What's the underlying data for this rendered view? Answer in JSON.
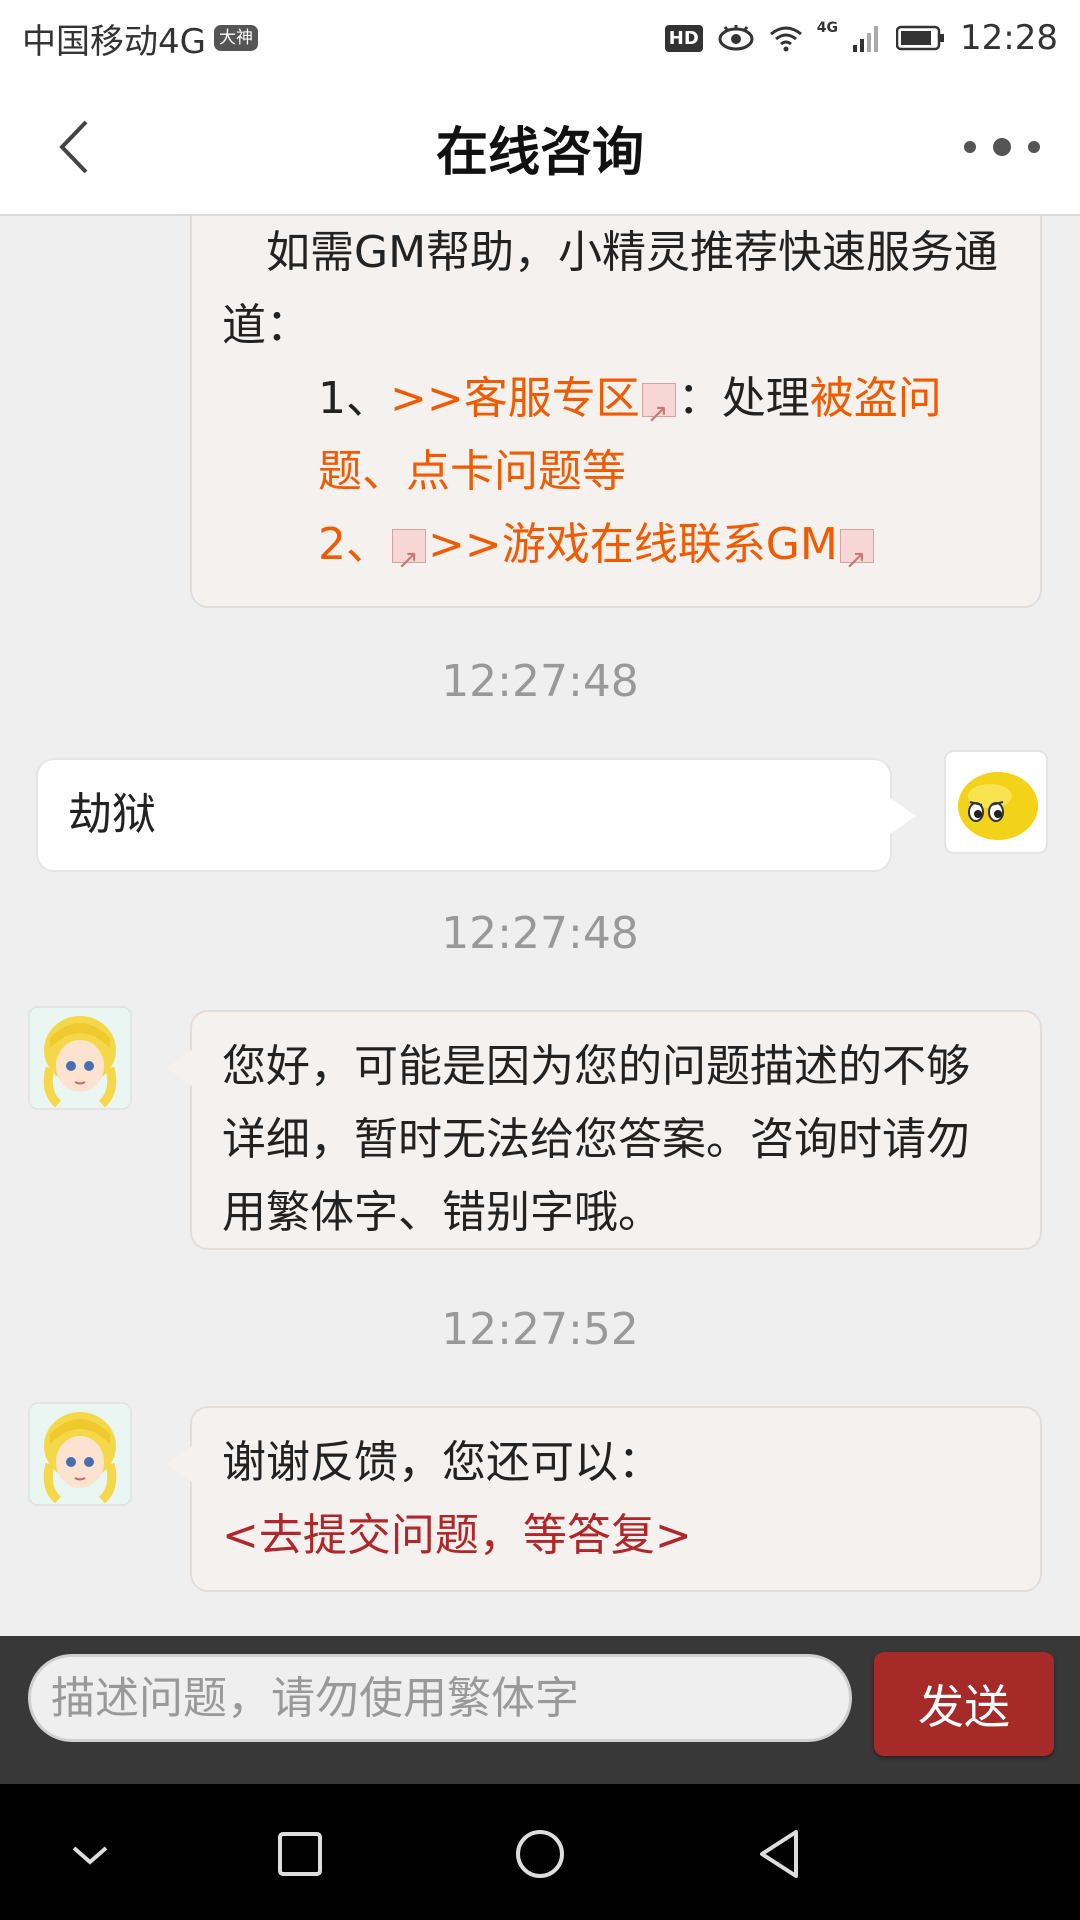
{
  "status_bar": {
    "carrier": "中国移动4G",
    "carrier_badge": "大神",
    "hd_label": "HD",
    "network_label": "4G",
    "time": "12:28"
  },
  "nav": {
    "title": "在线咨询",
    "back_icon": "chevron-left-icon",
    "more_icon": "more-dots-icon"
  },
  "messages": {
    "m1": {
      "line1": "如需GM帮助，小精灵推荐快速服务通道：",
      "item1_prefix": "1、",
      "item1_link": ">>客服专区",
      "item1_mid": "：处理",
      "item1_highlight": "被盗问题、点卡问题等",
      "item2_prefix": "2、",
      "item2_link": ">>游戏在线联系GM"
    },
    "t1": "12:27:48",
    "m2": {
      "text": "劫狱"
    },
    "t2": "12:27:48",
    "m3": {
      "text": "您好，可能是因为您的问题描述的不够详细，暂时无法给您答案。咨询时请勿用繁体字、错别字哦。"
    },
    "t3": "12:27:52",
    "m4": {
      "text": "谢谢反馈，您还可以：",
      "link": "<去提交问题，等答复>"
    }
  },
  "input": {
    "placeholder": "描述问题，请勿使用繁体字",
    "value": "",
    "send_label": "发送"
  },
  "colors": {
    "link_orange": "#f25a00",
    "link_darkred": "#b0262a",
    "send_button": "#a52a28",
    "input_bar": "#383838"
  }
}
